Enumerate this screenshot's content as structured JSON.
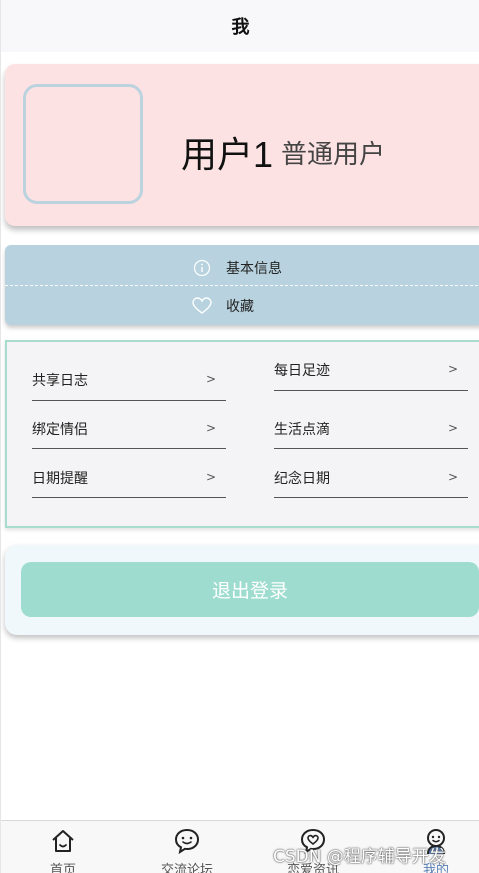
{
  "header": {
    "title": "我"
  },
  "profile": {
    "name": "用户1",
    "role": "普通用户"
  },
  "info": {
    "items": [
      {
        "label": "基本信息",
        "icon": "info-circle-icon"
      },
      {
        "label": "收藏",
        "icon": "heart-icon"
      }
    ]
  },
  "menu": {
    "items": [
      {
        "label": "共享日志",
        "arrow": ">"
      },
      {
        "label": "每日足迹",
        "arrow": ">"
      },
      {
        "label": "绑定情侣",
        "arrow": ">"
      },
      {
        "label": "生活点滴",
        "arrow": ">"
      },
      {
        "label": "日期提醒",
        "arrow": ">"
      },
      {
        "label": "纪念日期",
        "arrow": ">"
      }
    ]
  },
  "logout": {
    "label": "退出登录"
  },
  "tabbar": {
    "items": [
      {
        "label": "首页",
        "icon": "home-icon"
      },
      {
        "label": "交流论坛",
        "icon": "chat-bubble-icon"
      },
      {
        "label": "恋爱资讯",
        "icon": "heart-chat-icon"
      },
      {
        "label": "我的",
        "icon": "user-icon"
      }
    ]
  },
  "watermark": "CSDN @程序辅导开发",
  "colors": {
    "profile_bg": "#fde2e3",
    "info_bg": "#b8d3df",
    "menu_border": "#a8dccc",
    "logout_bg": "#9edcd0",
    "active_tab": "#5a7fb5"
  }
}
